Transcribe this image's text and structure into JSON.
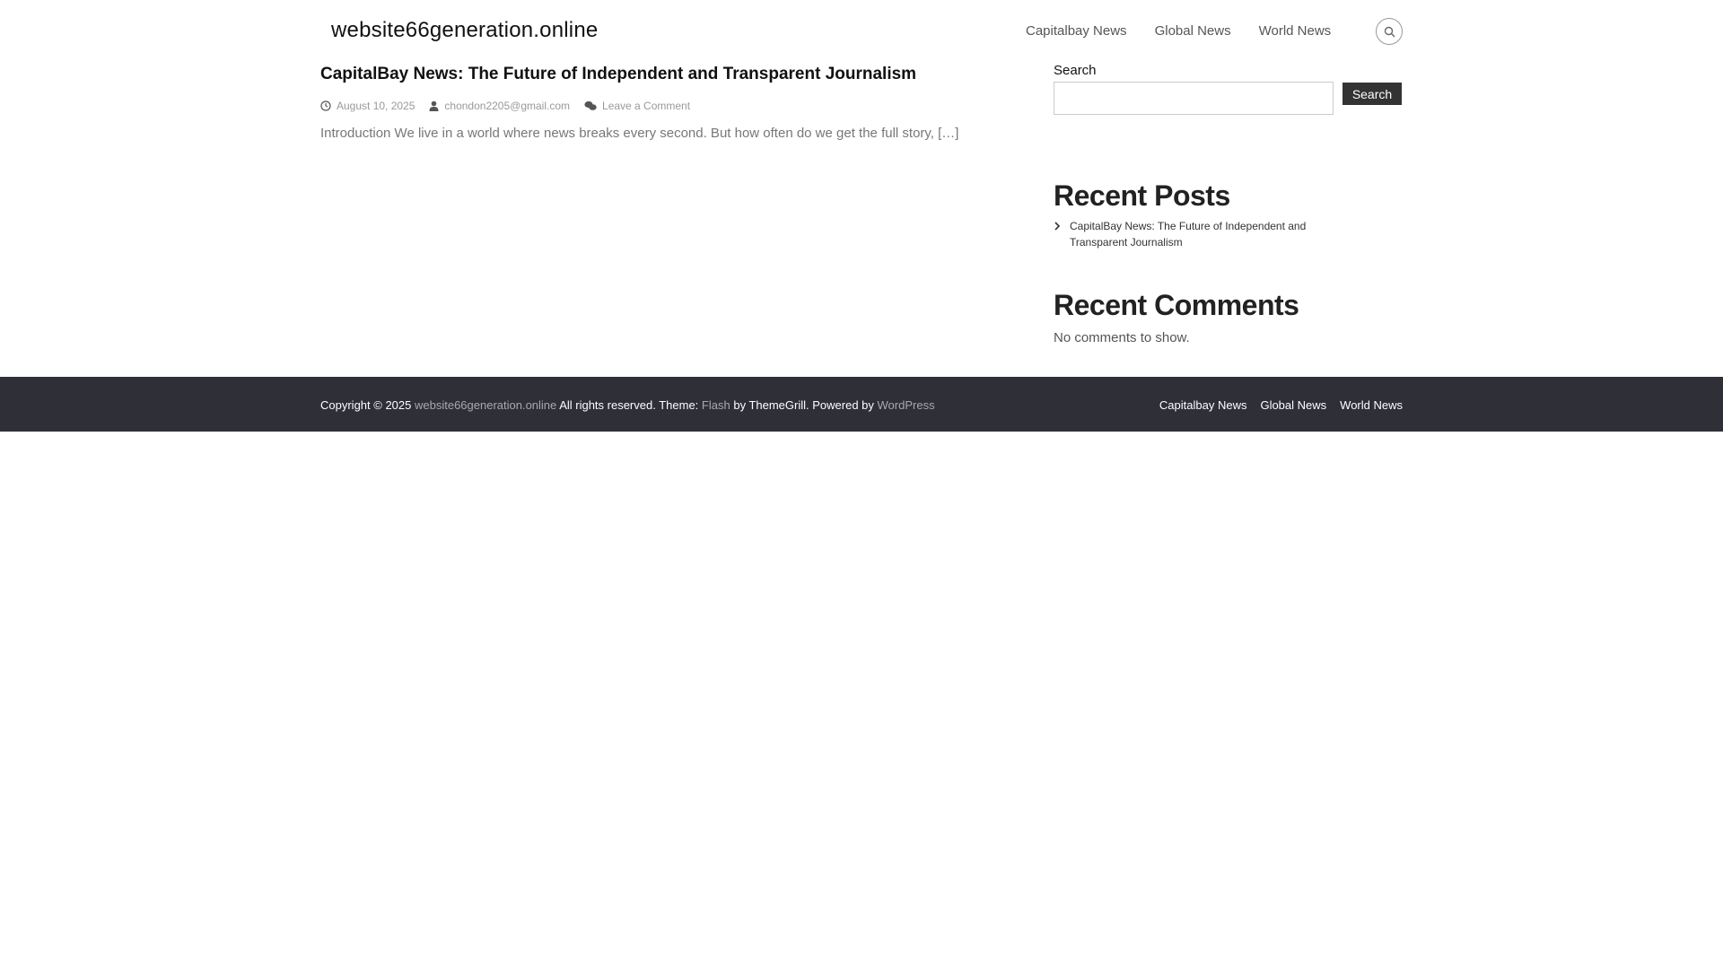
{
  "header": {
    "site_title": "website66generation.online",
    "nav": [
      {
        "label": "Capitalbay News"
      },
      {
        "label": "Global News"
      },
      {
        "label": "World News"
      }
    ],
    "search_icon": "search-icon"
  },
  "post": {
    "title": "CapitalBay News: The Future of Independent and Transparent Journalism",
    "date": "August 10, 2025",
    "author": "chondon2205@gmail.com",
    "comments": "Leave a Comment",
    "excerpt": "Introduction We live in a world where news breaks every second. But how often do we get the full story, […]"
  },
  "sidebar": {
    "search_label": "Search",
    "search_button": "Search",
    "search_placeholder": "",
    "recent_posts_title": "Recent Posts",
    "recent_posts": [
      {
        "label": "CapitalBay News: The Future of Independent and Transparent Journalism"
      }
    ],
    "recent_comments_title": "Recent Comments",
    "no_comments": "No comments to show."
  },
  "footer": {
    "copyright_prefix": "Copyright © 2025",
    "site_link": "website66generation.online",
    "rights_text": "All rights reserved. Theme:",
    "theme_link": "Flash",
    "by_text": "by ThemeGrill. Powered by",
    "wordpress_link": "WordPress",
    "nav": [
      {
        "label": "Capitalbay News"
      },
      {
        "label": "Global News"
      },
      {
        "label": "World News"
      }
    ]
  }
}
